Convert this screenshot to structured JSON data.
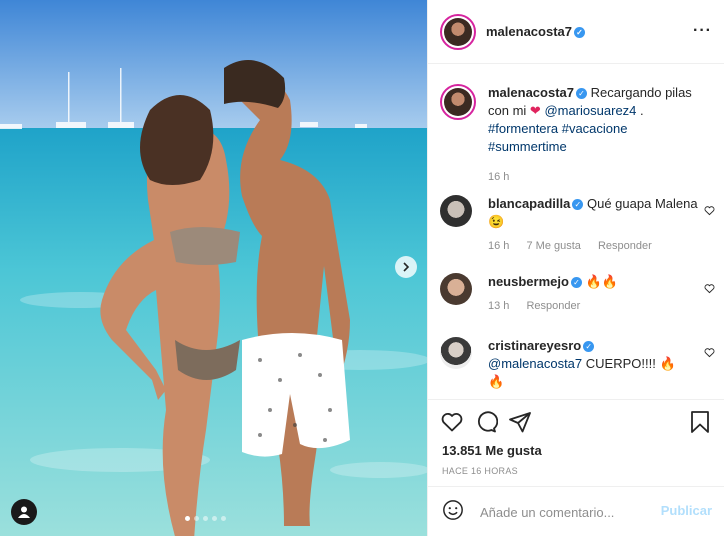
{
  "post": {
    "author": {
      "username": "malenacosta7",
      "verified_icon": "verified-badge-icon"
    },
    "caption": {
      "username": "malenacosta7",
      "text_before": "Recargando pilas con mi",
      "emoji_heart": "❤",
      "mention": "@mariosuarez4",
      "text_after": " .",
      "hashtags": [
        "#formentera",
        "#vacacione",
        "#summertime"
      ],
      "time": "16 h"
    },
    "comments": [
      {
        "username": "blancapadilla",
        "text": "Qué guapa Malena",
        "emoji": "😉",
        "time": "16 h",
        "likes": "7 Me gusta",
        "reply": "Responder"
      },
      {
        "username": "neusbermejo",
        "text": "",
        "emoji": "🔥🔥",
        "time": "13 h",
        "reply": "Responder"
      },
      {
        "username": "cristinareyesro",
        "mention": "@malenacosta7",
        "text": " CUERPO!!!!",
        "emoji": "🔥",
        "emoji2": "🔥"
      }
    ],
    "likes_count": "13.851 Me gusta",
    "timestamp": "HACE 16 HORAS",
    "comment_placeholder": "Añade un comentario...",
    "publish_label": "Publicar",
    "more_label": "···",
    "carousel": {
      "slides": 5,
      "active": 0
    },
    "colors": {
      "accent": "#3897f0",
      "publish_disabled": "#b2dffc",
      "link": "#00376b"
    }
  }
}
